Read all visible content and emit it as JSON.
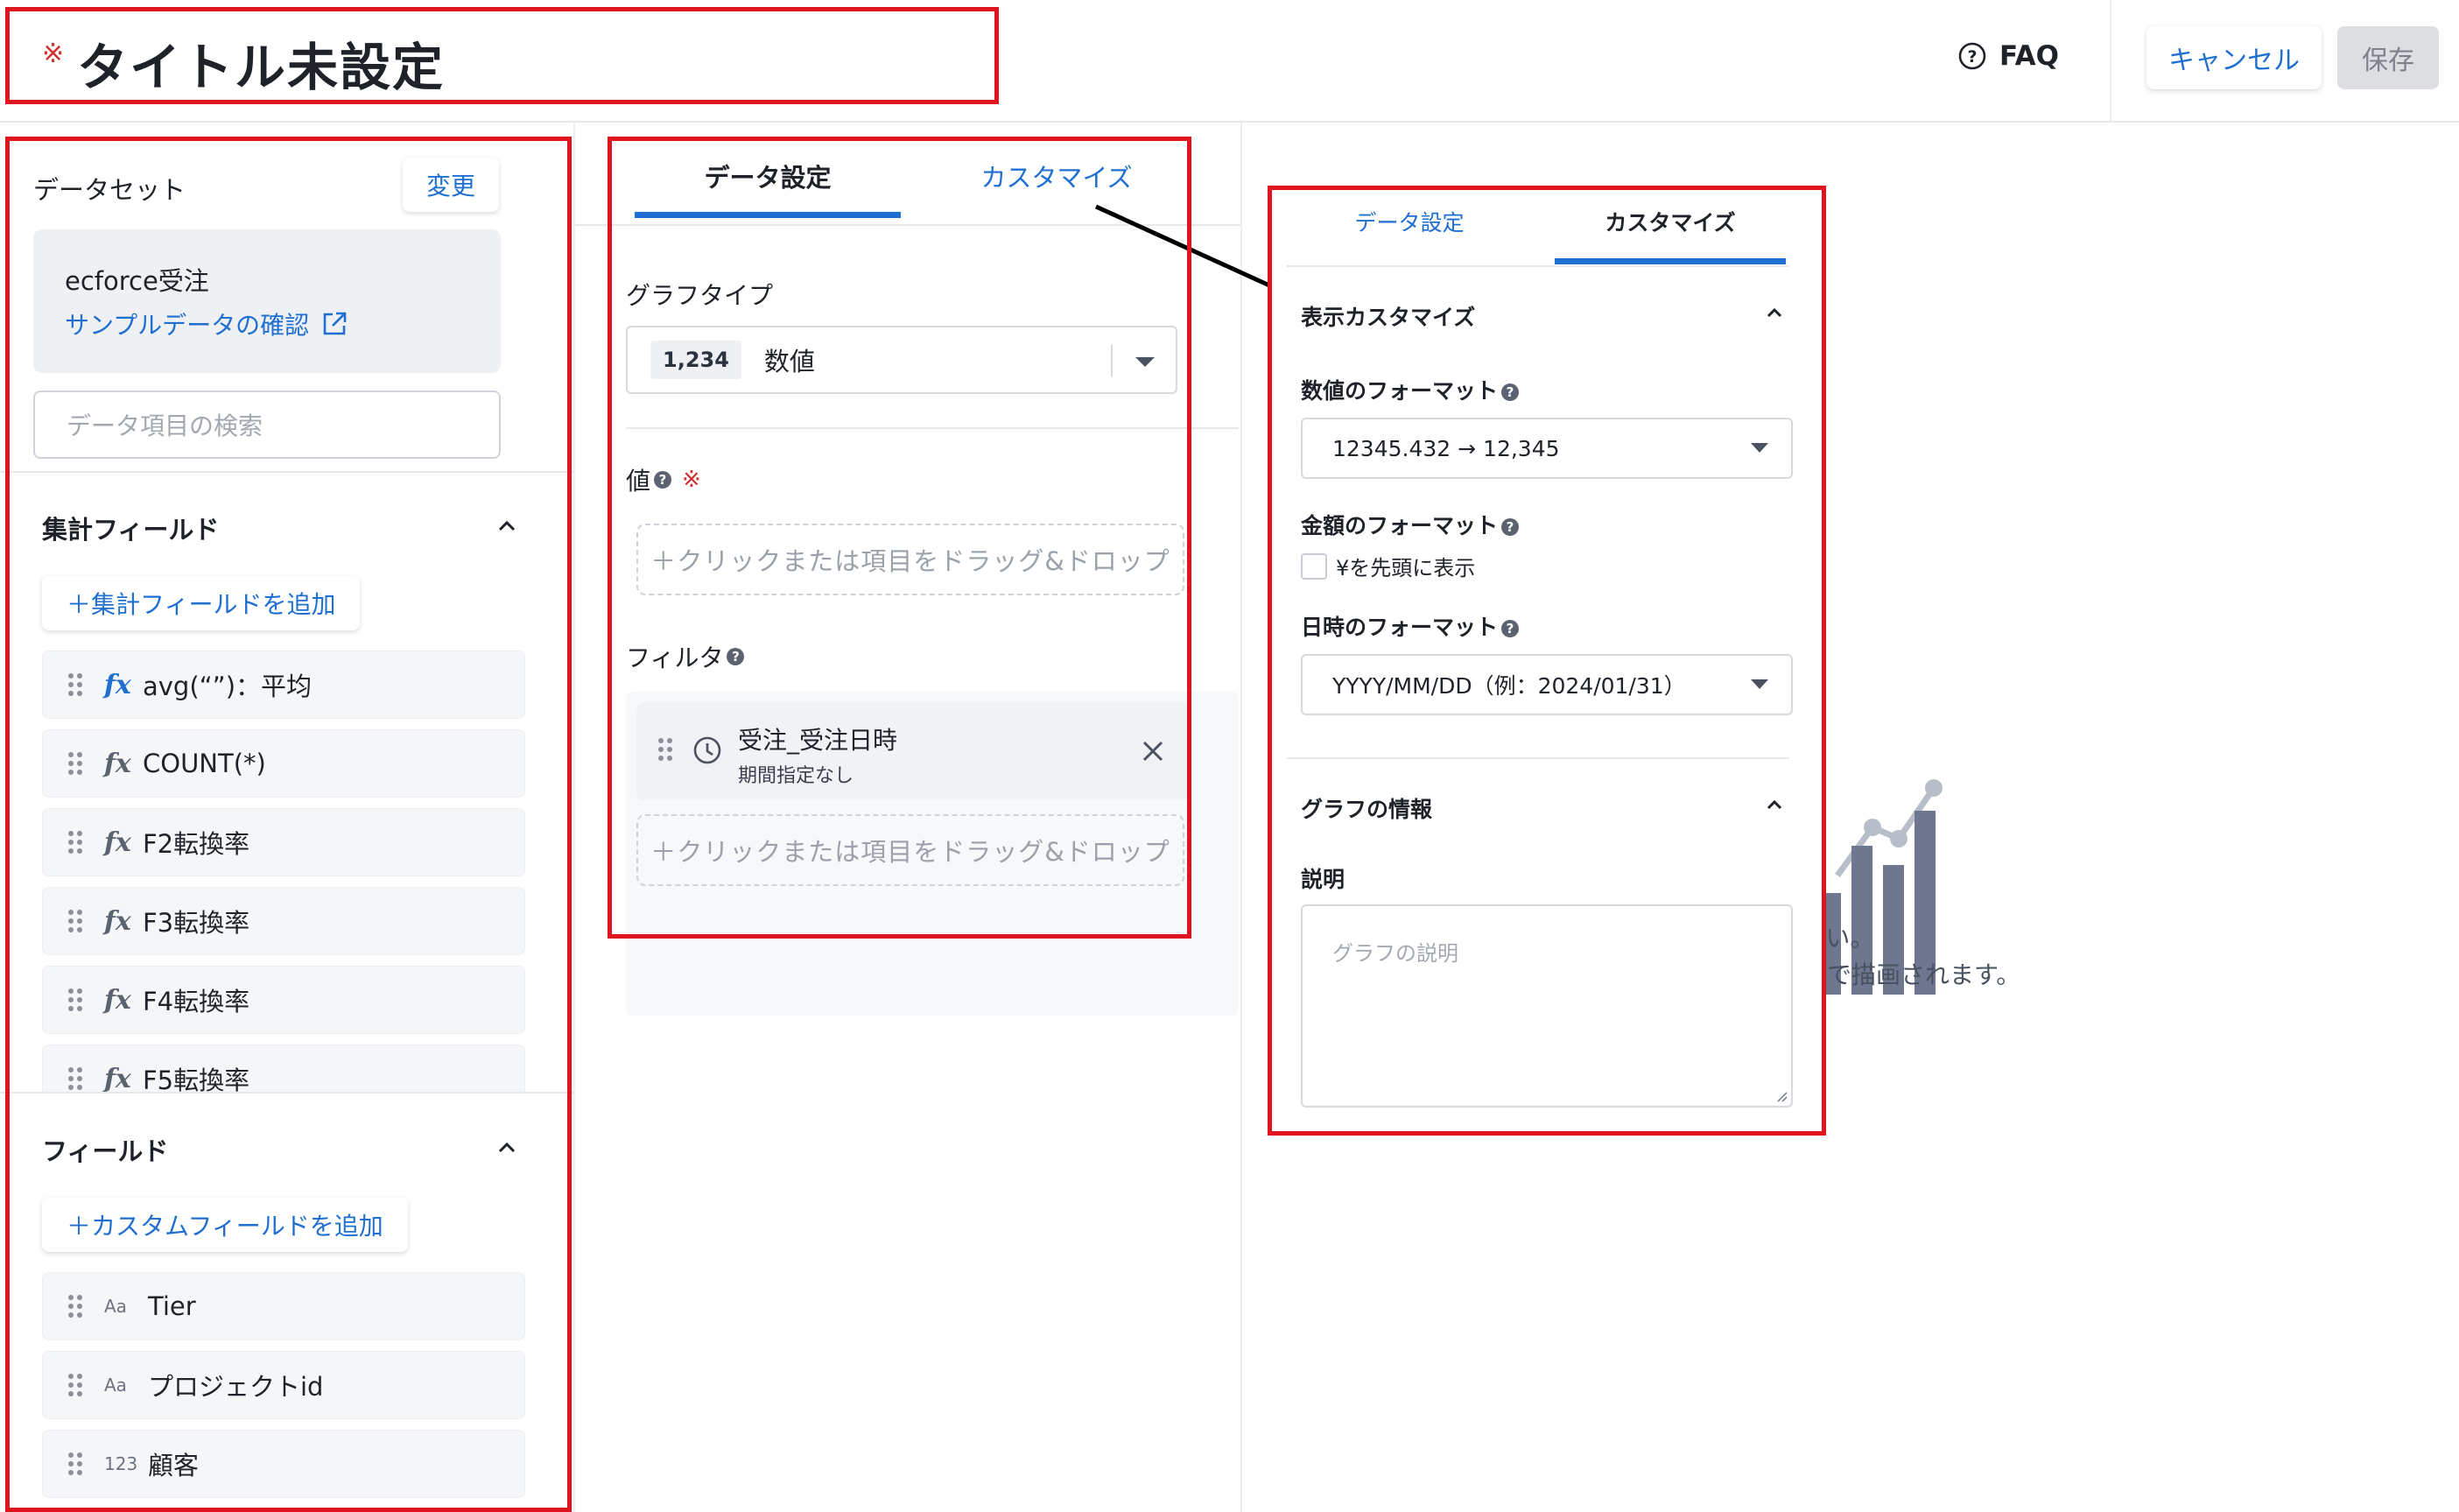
{
  "header": {
    "required_mark": "※",
    "title": "タイトル未設定",
    "faq_label": "FAQ",
    "cancel_label": "キャンセル",
    "save_label": "保存"
  },
  "dataset": {
    "label": "データセット",
    "change_label": "変更",
    "name": "ecforce受注",
    "sample_link": "サンプルデータの確認",
    "search_placeholder": "データ項目の検索"
  },
  "aggregate_fields": {
    "title": "集計フィールド",
    "add_label": "＋集計フィールドを追加",
    "items": [
      {
        "icon": "fx",
        "label": "avg(“”)：平均"
      },
      {
        "icon": "fx",
        "label": "COUNT(*)"
      },
      {
        "icon": "fx",
        "label": "F2転換率"
      },
      {
        "icon": "fx",
        "label": "F3転換率"
      },
      {
        "icon": "fx",
        "label": "F4転換率"
      },
      {
        "icon": "fx",
        "label": "F5転換率"
      }
    ]
  },
  "fields": {
    "title": "フィールド",
    "add_label": "＋カスタムフィールドを追加",
    "items": [
      {
        "type": "Aa",
        "label": "Tier"
      },
      {
        "type": "Aa",
        "label": "プロジェクトid"
      },
      {
        "type": "123",
        "label": "顧客"
      }
    ]
  },
  "middle": {
    "tabs": [
      "データ設定",
      "カスタマイズ"
    ],
    "graph_type_label": "グラフタイプ",
    "graph_type_badge": "1,234",
    "graph_type_value": "数値",
    "value_label": "値",
    "required_mark": "※",
    "dropzone_text": "＋クリックまたは項目をドラッグ&ドロップ",
    "filter_label": "フィルタ",
    "filter_item_title": "受注_受注日時",
    "filter_item_sub": "期間指定なし"
  },
  "customize": {
    "tabs": [
      "データ設定",
      "カスタマイズ"
    ],
    "display_section": "表示カスタマイズ",
    "number_format_label": "数値のフォーマット",
    "number_format_value": "12345.432 → 12,345",
    "currency_format_label": "金額のフォーマット",
    "currency_checkbox_label": "¥を先頭に表示",
    "date_format_label": "日時のフォーマット",
    "date_format_value": "YYYY/MM/DD（例：2024/01/31）",
    "graph_info_section": "グラフの情報",
    "description_label": "説明",
    "description_placeholder": "グラフの説明"
  },
  "preview": {
    "line1": "定してください。",
    "line2": "グラフが自動で描画されます。"
  },
  "colors": {
    "accent": "#1f6fd1",
    "highlight_border": "#e0141e",
    "placeholder_chart": "#6e7690"
  }
}
